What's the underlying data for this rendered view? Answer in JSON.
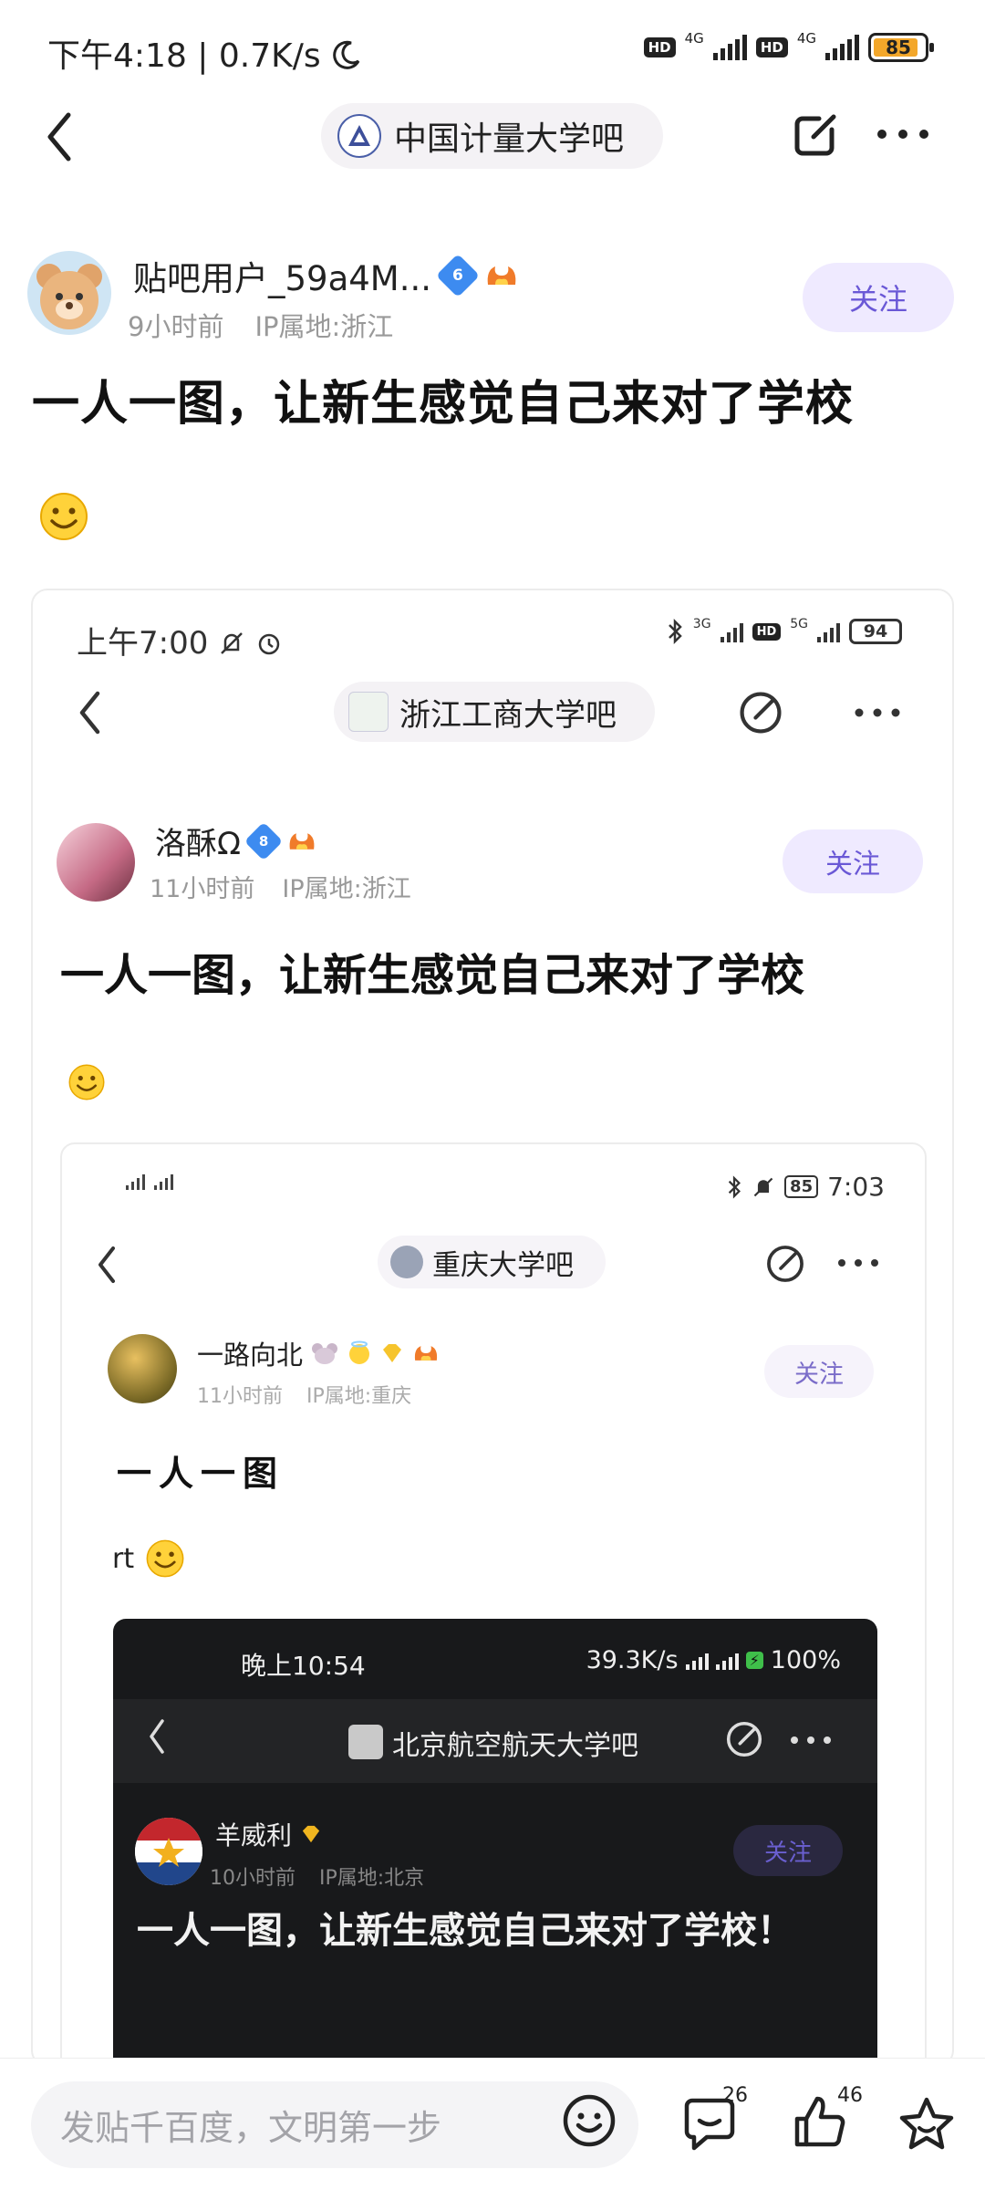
{
  "status_bar": {
    "time": "下午4:18",
    "speed": "0.7K/s",
    "net1": "4G",
    "net2": "4G",
    "battery": "85",
    "hd": "HD"
  },
  "nav": {
    "forum_name": "中国计量大学吧"
  },
  "post": {
    "username": "贴吧用户_59a4M...",
    "level": "6",
    "time_ago": "9小时前",
    "ip": "IP属地:浙江",
    "follow": "关注",
    "title": "一人一图，让新生感觉自己来对了学校"
  },
  "embedded_1": {
    "time": "上午7:00",
    "net1": "3G",
    "net2": "5G",
    "battery": "94",
    "forum_name": "浙江工商大学吧",
    "username": "洛酥Ω",
    "level": "8",
    "time_ago": "11小时前",
    "ip": "IP属地:浙江",
    "follow": "关注",
    "title": "一人一图，让新生感觉自己来对了学校"
  },
  "embedded_2": {
    "battery": "85",
    "time": "7:03",
    "forum_name": "重庆大学吧",
    "username": "一路向北",
    "time_ago": "11小时前",
    "ip": "IP属地:重庆",
    "follow": "关注",
    "title": "一人一图",
    "body": "rt"
  },
  "embedded_3": {
    "time": "晚上10:54",
    "speed": "39.3K/s",
    "battery": "100%",
    "forum_name": "北京航空航天大学吧",
    "username": "羊威利",
    "time_ago": "10小时前",
    "ip": "IP属地:北京",
    "follow": "关注",
    "title": "一人一图，让新生感觉自己来对了学校！"
  },
  "bottom_bar": {
    "reply_placeholder": "发贴千百度，文明第一步",
    "comment_count": "26",
    "like_count": "46"
  },
  "colors": {
    "accent": "#6a58d6",
    "follow_bg": "#efeaff",
    "pill_bg": "#f4f2f5"
  }
}
